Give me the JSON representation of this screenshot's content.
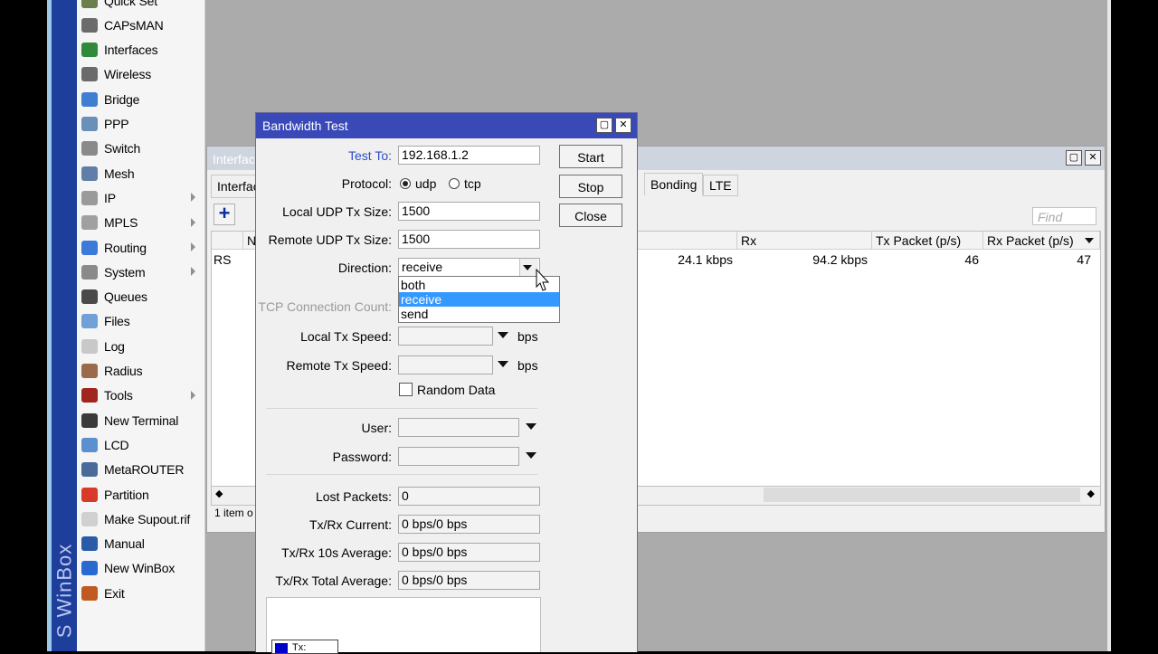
{
  "app": {
    "brand": "S WinBox",
    "accent": "#1d3e9a"
  },
  "menu": {
    "items": [
      {
        "label": "Quick Set",
        "icon": "quick-set-icon",
        "color": "#6a7f4a",
        "arrow": false
      },
      {
        "label": "CAPsMAN",
        "icon": "antenna-icon",
        "color": "#6b6b6b",
        "arrow": false
      },
      {
        "label": "Interfaces",
        "icon": "interfaces-icon",
        "color": "#2f8a3a",
        "arrow": false
      },
      {
        "label": "Wireless",
        "icon": "wireless-icon",
        "color": "#6b6b6b",
        "arrow": false
      },
      {
        "label": "Bridge",
        "icon": "bridge-icon",
        "color": "#3e7fd1",
        "arrow": false
      },
      {
        "label": "PPP",
        "icon": "ppp-icon",
        "color": "#6a8fb8",
        "arrow": false
      },
      {
        "label": "Switch",
        "icon": "switch-icon",
        "color": "#8a8a8a",
        "arrow": false
      },
      {
        "label": "Mesh",
        "icon": "mesh-icon",
        "color": "#5f7fa8",
        "arrow": false
      },
      {
        "label": "IP",
        "icon": "ip-icon",
        "color": "#9a9a9a",
        "arrow": true
      },
      {
        "label": "MPLS",
        "icon": "mpls-icon",
        "color": "#a0a0a0",
        "arrow": true
      },
      {
        "label": "Routing",
        "icon": "routing-icon",
        "color": "#3b7ad8",
        "arrow": true
      },
      {
        "label": "System",
        "icon": "gear-icon",
        "color": "#8a8a8a",
        "arrow": true
      },
      {
        "label": "Queues",
        "icon": "queues-icon",
        "color": "#4a4a4a",
        "arrow": false
      },
      {
        "label": "Files",
        "icon": "folder-icon",
        "color": "#6fa0d8",
        "arrow": false
      },
      {
        "label": "Log",
        "icon": "log-icon",
        "color": "#c8c8c8",
        "arrow": false
      },
      {
        "label": "Radius",
        "icon": "radius-icon",
        "color": "#9a6a4a",
        "arrow": false
      },
      {
        "label": "Tools",
        "icon": "tools-icon",
        "color": "#a0251e",
        "arrow": true
      },
      {
        "label": "New Terminal",
        "icon": "terminal-icon",
        "color": "#3a3a3a",
        "arrow": false
      },
      {
        "label": "LCD",
        "icon": "lcd-icon",
        "color": "#5a8fd0",
        "arrow": false
      },
      {
        "label": "MetaROUTER",
        "icon": "metarouter-icon",
        "color": "#4a6a9a",
        "arrow": false
      },
      {
        "label": "Partition",
        "icon": "partition-icon",
        "color": "#d83a2a",
        "arrow": false
      },
      {
        "label": "Make Supout.rif",
        "icon": "document-icon",
        "color": "#d0d0d0",
        "arrow": false
      },
      {
        "label": "Manual",
        "icon": "help-icon",
        "color": "#2a5aa8",
        "arrow": false
      },
      {
        "label": "New WinBox",
        "icon": "winbox-icon",
        "color": "#2a6ad0",
        "arrow": false
      },
      {
        "label": "Exit",
        "icon": "exit-icon",
        "color": "#c05a20",
        "arrow": false
      }
    ]
  },
  "interfaces_window": {
    "title": "Interfac",
    "tab_partial": "Interfac",
    "tabs": [
      "Bonding",
      "LTE"
    ],
    "find_placeholder": "Find",
    "status": "1 item o",
    "columns": {
      "name": "Na",
      "rx": "Rx",
      "tx_packet": "Tx Packet (p/s)",
      "rx_packet": "Rx Packet (p/s)"
    },
    "row": {
      "flag": "RS",
      "tx": "24.1 kbps",
      "rx": "94.2 kbps",
      "tx_packet": "46",
      "rx_packet": "47"
    }
  },
  "dialog": {
    "title": "Bandwidth Test",
    "test_to": {
      "label": "Test To:",
      "value": "192.168.1.2"
    },
    "protocol": {
      "label": "Protocol:",
      "options": [
        "udp",
        "tcp"
      ],
      "selected": "udp"
    },
    "local_udp": {
      "label": "Local UDP Tx Size:",
      "value": "1500"
    },
    "remote_udp": {
      "label": "Remote UDP Tx Size:",
      "value": "1500"
    },
    "direction": {
      "label": "Direction:",
      "value": "receive",
      "options": [
        "both",
        "receive",
        "send"
      ]
    },
    "tcp_count": {
      "label": "TCP Connection Count:"
    },
    "local_speed": {
      "label": "Local Tx Speed:",
      "unit": "bps"
    },
    "remote_speed": {
      "label": "Remote Tx Speed:",
      "unit": "bps"
    },
    "random_data": {
      "label": "Random Data"
    },
    "user": {
      "label": "User:"
    },
    "password": {
      "label": "Password:"
    },
    "lost_packets": {
      "label": "Lost Packets:",
      "value": "0"
    },
    "current": {
      "label": "Tx/Rx Current:",
      "value": "0 bps/0 bps"
    },
    "avg10": {
      "label": "Tx/Rx 10s Average:",
      "value": "0 bps/0 bps"
    },
    "total": {
      "label": "Tx/Rx Total Average:",
      "value": "0 bps/0 bps"
    },
    "buttons": {
      "start": "Start",
      "stop": "Stop",
      "close": "Close"
    },
    "legend": {
      "tx": "Tx:"
    }
  }
}
